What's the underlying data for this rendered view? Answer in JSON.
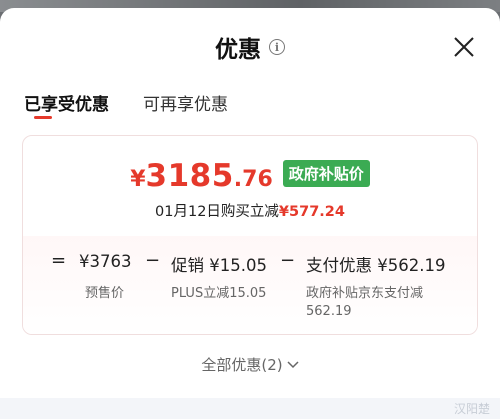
{
  "dialog": {
    "title": "优惠",
    "close_label": "×"
  },
  "tabs": [
    {
      "label": "已享受优惠",
      "active": true
    },
    {
      "label": "可再享优惠",
      "active": false
    }
  ],
  "price": {
    "currency": "¥",
    "integer": "3185",
    "decimal": ".76",
    "badge": "政府补贴价"
  },
  "purchase": {
    "text": "01月12日购买立减",
    "amount": "¥577.24"
  },
  "breakdown": {
    "equals": "=",
    "presale_amount": "¥3763",
    "presale_label": "预售价",
    "minus1": "−",
    "promo_amount": "促销 ¥15.05",
    "promo_label": "PLUS立减15.05",
    "minus2": "−",
    "payment_amount": "支付优惠 ¥562.19",
    "payment_label_line1": "政府补贴京东支付减",
    "payment_label_line2": "562.19"
  },
  "all_discounts": "全部优惠(2)",
  "watermark": "汉阳楚",
  "colors": {
    "accent_red": "#e5392b",
    "badge_green": "#3bab53"
  }
}
